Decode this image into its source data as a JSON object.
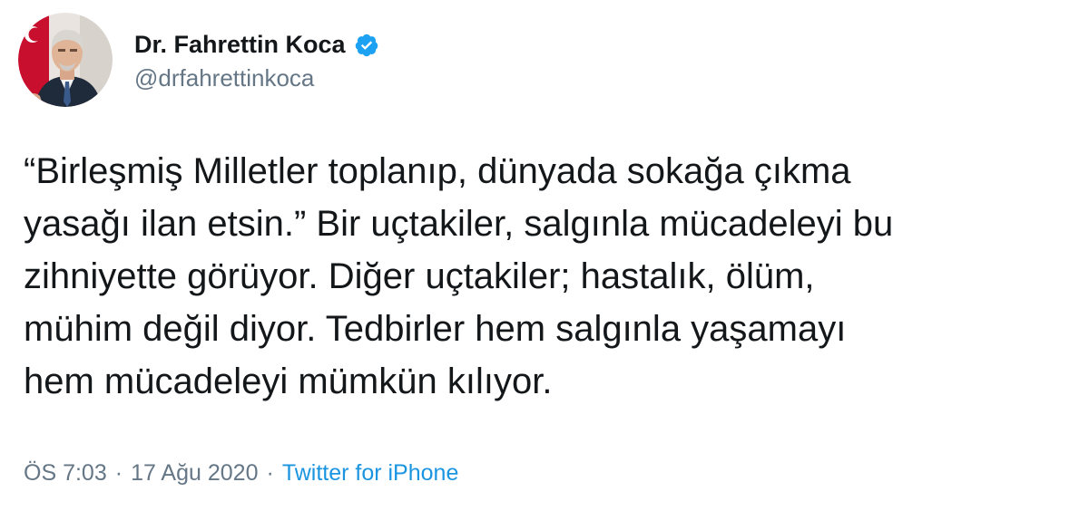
{
  "author": {
    "display_name": "Dr. Fahrettin Koca",
    "handle": "@drfahrettinkoca",
    "verified_icon": "verified-badge-icon",
    "verified_color": "#1da1f2"
  },
  "tweet": {
    "text": "“Birleşmiş Milletler toplanıp, dünyada sokağa çıkma\nyasağı ilan etsin.” Bir uçtakiler, salgınla mücadeleyi bu\nzihniyette görüyor. Diğer uçtakiler; hastalık, ölüm,\nmühim değil diyor. Tedbirler hem salgınla yaşamayı\nhem mücadeleyi mümkün kılıyor.",
    "time": "ÖS 7:03",
    "separator": "·",
    "date": "17 Ağu 2020",
    "source": "Twitter for iPhone"
  },
  "colors": {
    "text": "#14171a",
    "secondary": "#657786",
    "link": "#1b95e0"
  }
}
